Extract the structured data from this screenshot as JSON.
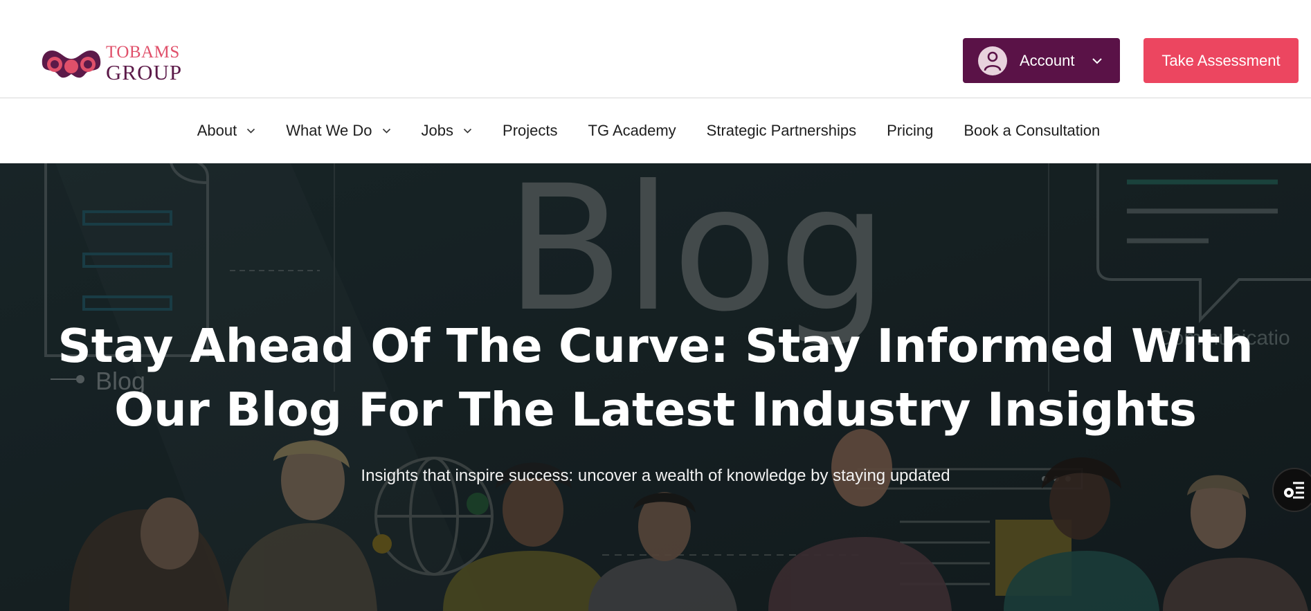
{
  "header": {
    "logo": {
      "line1": "TOBAMS",
      "line2": "GROUP",
      "icon": "people-logo-icon"
    },
    "account": {
      "label": "Account",
      "icon": "user-avatar-icon",
      "caret_icon": "chevron-down-icon"
    },
    "assessment_button": "Take Assessment"
  },
  "nav": {
    "items": [
      {
        "label": "About",
        "has_dropdown": true
      },
      {
        "label": "What We Do",
        "has_dropdown": true
      },
      {
        "label": "Jobs",
        "has_dropdown": true
      },
      {
        "label": "Projects",
        "has_dropdown": false
      },
      {
        "label": "TG Academy",
        "has_dropdown": false
      },
      {
        "label": "Strategic Partnerships",
        "has_dropdown": false
      },
      {
        "label": "Pricing",
        "has_dropdown": false
      },
      {
        "label": "Book a Consultation",
        "has_dropdown": false
      }
    ]
  },
  "hero": {
    "title_line1": "Stay Ahead Of The Curve: Stay Informed With",
    "title_line2": "Our Blog For The Latest Industry Insights",
    "subtitle": "Insights that inspire success: uncover a wealth of knowledge by staying updated",
    "background": {
      "big_word": "Blog",
      "left_label": "Blog",
      "right_label": "Communicatio"
    },
    "side_tool_icon": "accessibility-menu-icon"
  },
  "colors": {
    "brand_purple": "#5a1247",
    "brand_pink": "#ec4660",
    "hero_overlay": "#172224"
  }
}
